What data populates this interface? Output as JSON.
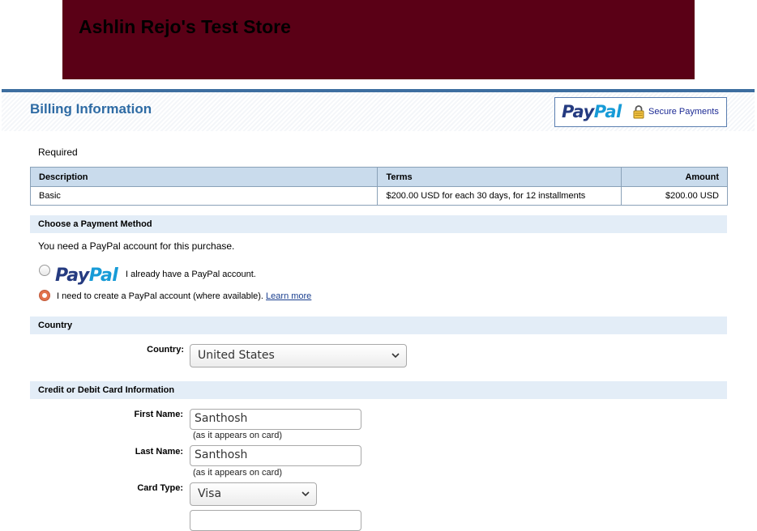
{
  "store": {
    "title": "Ashlin Rejo's Test Store"
  },
  "billing": {
    "title": "Billing Information",
    "secure_logo_part1": "Pay",
    "secure_logo_part2": "Pal",
    "secure_text": "Secure Payments"
  },
  "required_label": "Required",
  "items_table": {
    "headers": {
      "description": "Description",
      "terms": "Terms",
      "amount": "Amount"
    },
    "rows": [
      {
        "description": "Basic",
        "terms": "$200.00 USD for each 30 days, for 12 installments",
        "amount": "$200.00 USD"
      }
    ]
  },
  "payment_method": {
    "heading": "Choose a Payment Method",
    "note": "You need a PayPal account for this purchase.",
    "logo_part1": "Pay",
    "logo_part2": "Pal",
    "option_existing": "I already have a PayPal account.",
    "option_create": "I need to create a PayPal account (where available).",
    "learn_more": "Learn more",
    "selected": "create"
  },
  "country": {
    "heading": "Country",
    "label": "Country:",
    "value": "United States"
  },
  "card": {
    "heading": "Credit or Debit Card Information",
    "first_name_label": "First Name:",
    "first_name_value": "Santhosh",
    "first_name_hint": "(as it appears on card)",
    "last_name_label": "Last Name:",
    "last_name_value": "Santhosh",
    "last_name_hint": "(as it appears on card)",
    "card_type_label": "Card Type:",
    "card_type_value": "Visa"
  },
  "colors": {
    "banner": "#5a0016",
    "accent": "#3d6ea0",
    "title": "#2e6ba4",
    "section": "#e3edf7",
    "radio_selected": "#e2734c"
  }
}
